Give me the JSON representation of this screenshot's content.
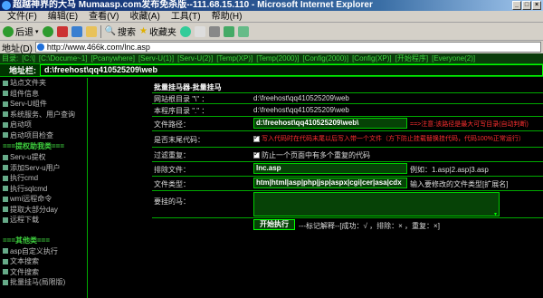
{
  "window": {
    "title": "超越神界的大马 Mumaasp.com发布免杀版--111.68.15.110 - Microsoft Internet Explorer",
    "min": "_",
    "max": "□",
    "close": "×"
  },
  "menu": [
    "文件(F)",
    "编辑(E)",
    "查看(V)",
    "收藏(A)",
    "工具(T)",
    "帮助(H)"
  ],
  "toolbar": {
    "back": "后退",
    "search": "搜索",
    "favorites": "收藏夹"
  },
  "address": {
    "label": "地址(D)",
    "url": "http://www.466k.com/lnc.asp"
  },
  "linkbar": [
    "目录:",
    "[C:\\]",
    "[C:\\Docume~1]",
    "[Pcanywhere]",
    "[Serv-U(1)]",
    "[Serv-U(2)]",
    "[Temp(XP)]",
    "[Temp(2000)]",
    "[Config(2000)]",
    "[Config(XP)]",
    "[开始程序]",
    "[Everyone(2)]"
  ],
  "path": {
    "label": "地址栏:",
    "value": "d:\\freehost\\qq410525209\\web"
  },
  "sidebar": {
    "items_top": [
      "站点文件夹",
      "组件信息",
      "Serv-U组件",
      "系统服务、用户查询",
      "启动项",
      "启动项目检查"
    ],
    "group1_title": "===提权助我类===",
    "items_mid": [
      "Serv-u提权",
      "添加Serv-u用户",
      "执行cmd",
      "执行sqlcmd",
      "wmi远程命令",
      "提取大部分day",
      "远程下载"
    ],
    "group2_title": "===其他类===",
    "items_bottom": [
      "asp自定义执行",
      "文本搜索",
      "文件搜索",
      "批量挂马(局限版)"
    ]
  },
  "panel": {
    "title": "批量挂马器-批量挂马",
    "web_root_label": "网站根目录 \"\\\" ：",
    "web_root_value": "d:\\freehost\\qq410525209\\web",
    "current_dir_label": "本程序目录 \".\" ：",
    "current_dir_value": "d:\\freehost\\qq410525209\\web",
    "file_path_label": "文件路径：",
    "file_path_value": "d:\\freehost\\qq410525209\\web\\",
    "file_path_hint": "==>注意:该路径是最大可写目录(自动判断)",
    "append_label": "是否末尾代码：",
    "append_text": "写入代码时在代码末尾以后写入带一个文件（方下防止挂载替换挂代码，代码100%正常运行）",
    "filter_label": "过滤重复：",
    "filter_text": "防止一个页面中有多个重复的代码",
    "exclude_label": "排除文件：",
    "exclude_value": "lnc.asp",
    "exclude_example": "例如：1.asp|2.asp|3.asp",
    "filetype_label": "文件类型：",
    "filetype_value": "htm|html|asp|php|jsp|aspx|cgi|cer|asa|cdx",
    "filetype_hint": "输入要修改的文件类型[扩展名]",
    "code_label": "要挂的马：",
    "code_value": "",
    "exec_button": "开始执行",
    "legend": "---标记解释--[成功：√ ，排除：× ，重复：×]"
  },
  "colors": {
    "accent_green": "#00cc00",
    "field_bg": "#064206",
    "warn": "#ff3030"
  }
}
